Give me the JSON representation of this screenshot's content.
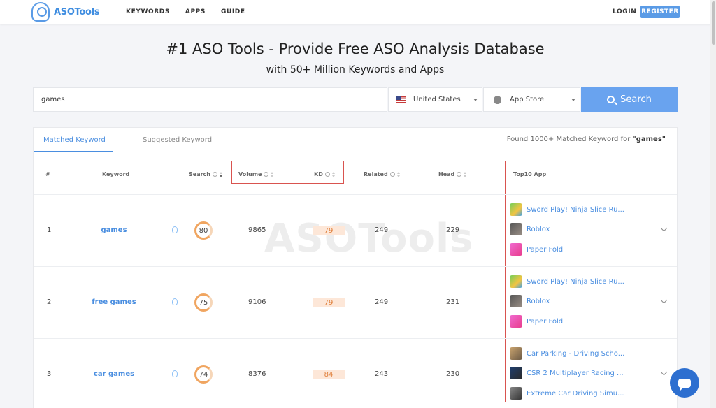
{
  "nav": {
    "logo": "ASOTools",
    "links": [
      "KEYWORDS",
      "APPS",
      "GUIDE"
    ],
    "login": "LOGIN",
    "register": "REGISTER"
  },
  "hero": {
    "title": "#1 ASO Tools - Provide Free ASO Analysis Database",
    "subtitle": "with 50+ Million Keywords and Apps"
  },
  "search": {
    "query": "games",
    "country": "United States",
    "store": "App Store",
    "button": "Search"
  },
  "tabs": {
    "matched": "Matched Keyword",
    "suggested": "Suggested Keyword"
  },
  "found": {
    "prefix": "Found",
    "count": "1000+",
    "middle": "Matched Keyword for",
    "term": "\"games\""
  },
  "columns": {
    "num": "#",
    "keyword": "Keyword",
    "search": "Search",
    "volume": "Volume",
    "kd": "KD",
    "related": "Related",
    "head": "Head",
    "top10": "Top10 App"
  },
  "watermark": "ASOTools",
  "rows": [
    {
      "num": "1",
      "keyword": "games",
      "search": "80",
      "volume": "9865",
      "kd": "79",
      "related": "249",
      "head": "229",
      "apps": [
        "Sword Play! Ninja Slice Ru...",
        "Roblox",
        "Paper Fold"
      ]
    },
    {
      "num": "2",
      "keyword": "free games",
      "search": "75",
      "volume": "9106",
      "kd": "79",
      "related": "249",
      "head": "231",
      "apps": [
        "Sword Play! Ninja Slice Ru...",
        "Roblox",
        "Paper Fold"
      ]
    },
    {
      "num": "3",
      "keyword": "car games",
      "search": "74",
      "volume": "8376",
      "kd": "84",
      "related": "243",
      "head": "230",
      "apps": [
        "Car Parking - Driving Scho...",
        "CSR 2 Multiplayer Racing ...",
        "Extreme Car Driving Simu..."
      ]
    }
  ],
  "colors": {
    "accent": "#4a8ee0",
    "button": "#69a3ef",
    "highlight": "#d9534f",
    "kd_bg": "#fde7d8",
    "ring": "#f0a560"
  }
}
